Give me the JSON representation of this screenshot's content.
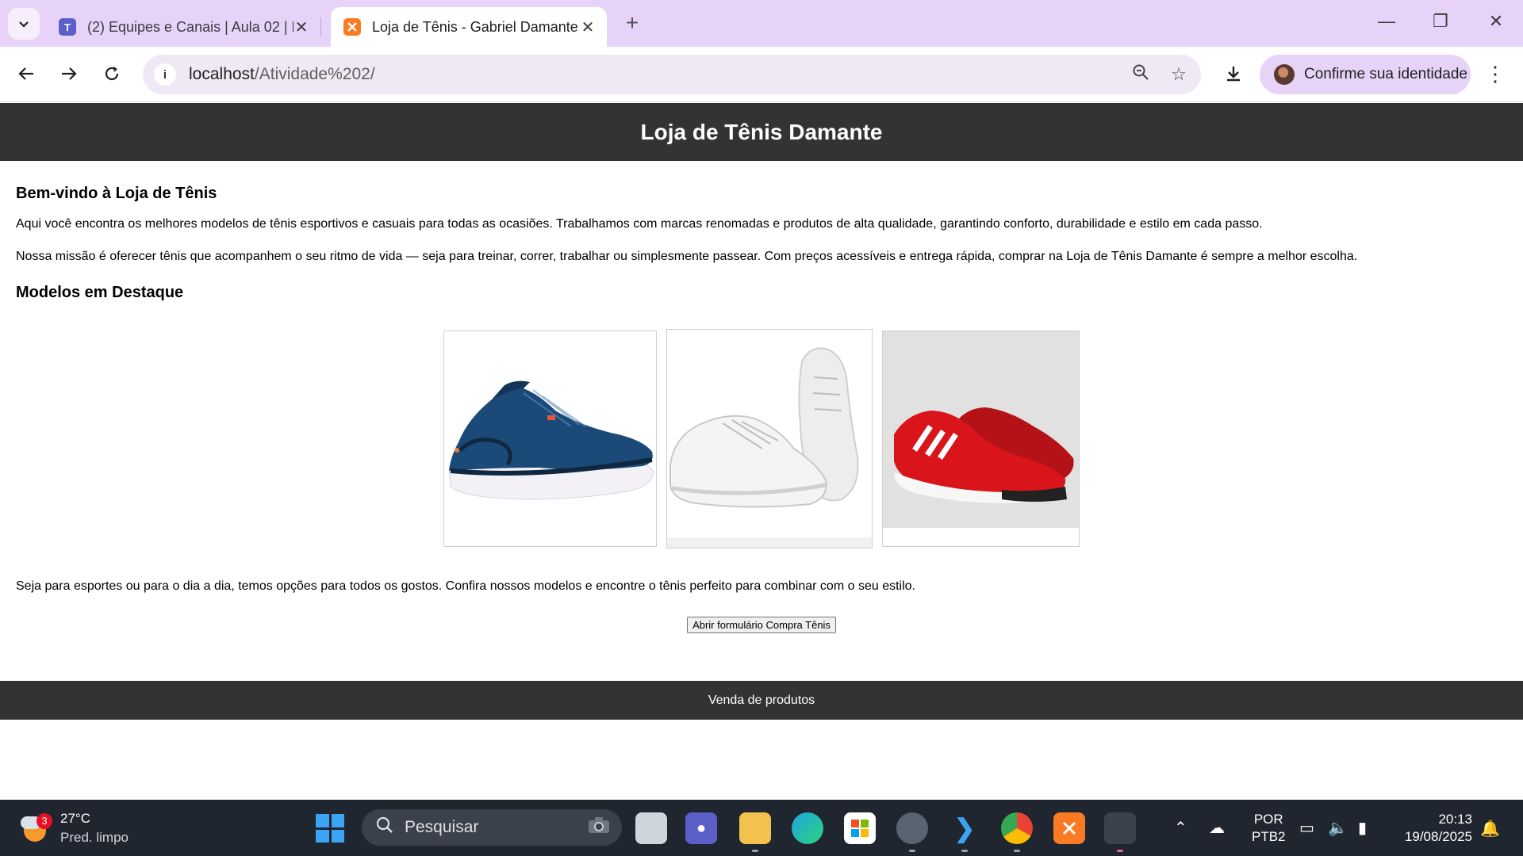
{
  "browser": {
    "tabs": [
      {
        "title": "(2) Equipes e Canais | Aula 02 | M",
        "active": false
      },
      {
        "title": "Loja de Tênis - Gabriel Damante",
        "active": true
      }
    ],
    "new_tab_label": "+",
    "close_label": "✕",
    "address": {
      "host": "localhost",
      "path": "/Atividade%202/"
    },
    "profile_label": "Confirme sua identidade",
    "window_controls": {
      "minimize": "—",
      "restore": "❐",
      "close": "✕"
    }
  },
  "page": {
    "header_title": "Loja de Tênis Damante",
    "welcome_heading": "Bem-vindo à Loja de Tênis",
    "intro_paragraph": "Aqui você encontra os melhores modelos de tênis esportivos e casuais para todas as ocasiões. Trabalhamos com marcas renomadas e produtos de alta qualidade, garantindo conforto, durabilidade e estilo em cada passo.",
    "mission_paragraph": "Nossa missão é oferecer tênis que acompanhem o seu ritmo de vida — seja para treinar, correr, trabalhar ou simplesmente passear. Com preços acessíveis e entrega rápida, comprar na Loja de Tênis Damante é sempre a melhor escolha.",
    "featured_heading": "Modelos em Destaque",
    "products": [
      {
        "name": "blue-running-shoe",
        "color": "#1c4a78"
      },
      {
        "name": "white-casual-sneaker",
        "color": "#f2f2f2"
      },
      {
        "name": "red-sport-shoe",
        "color": "#d9151b"
      }
    ],
    "closing_paragraph": "Seja para esportes ou para o dia a dia, temos opções para todos os gostos. Confira nossos modelos e encontre o tênis perfeito para combinar com o seu estilo.",
    "buy_button_label": "Abrir formulário Compra Tênis",
    "footer_text": "Venda de produtos",
    "header_color": "#333333"
  },
  "taskbar": {
    "weather_temp": "27°C",
    "weather_desc": "Pred. limpo",
    "weather_badge": "3",
    "search_placeholder": "Pesquisar",
    "language_line1": "POR",
    "language_line2": "PTB2",
    "time": "20:13",
    "date": "19/08/2025"
  }
}
